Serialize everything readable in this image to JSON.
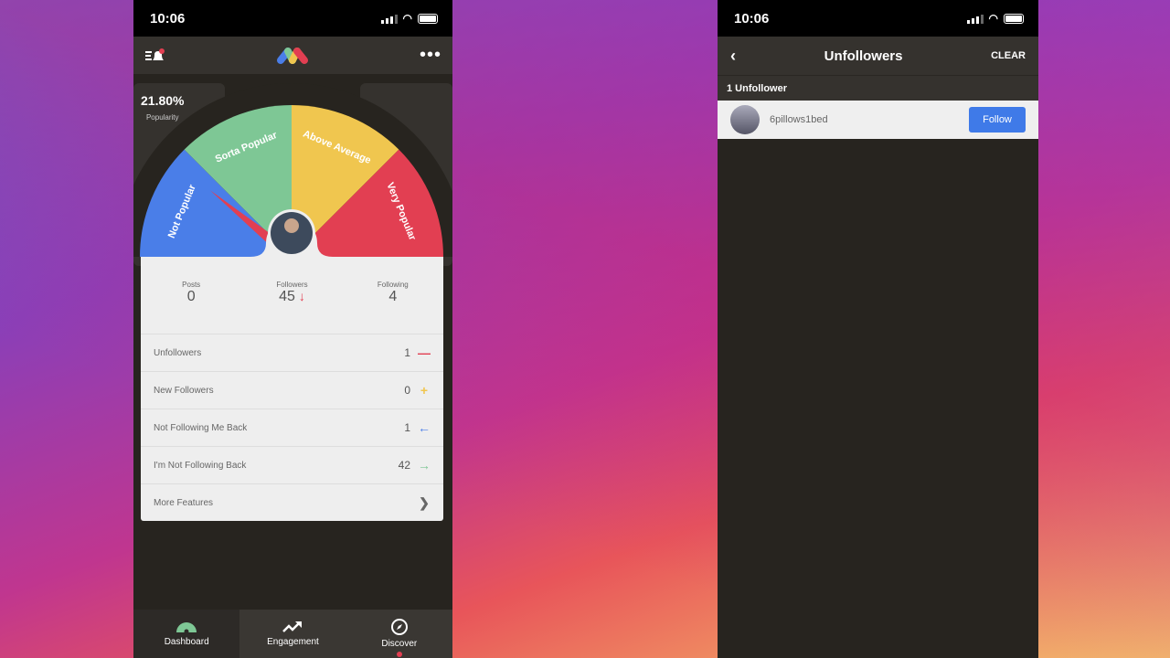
{
  "left": {
    "status": {
      "time": "10:06"
    },
    "popularity": {
      "value": "21.80%",
      "label": "Popularity",
      "fraction": 0.218
    },
    "gauge": {
      "segments": [
        {
          "label": "Not Popular",
          "color": "#4a7ee8"
        },
        {
          "label": "Sorta Popular",
          "color": "#7ec795"
        },
        {
          "label": "Above Average",
          "color": "#f0c64f"
        },
        {
          "label": "Very Popular",
          "color": "#e23f52"
        }
      ]
    },
    "stats": [
      {
        "label": "Posts",
        "value": "0"
      },
      {
        "label": "Followers",
        "value": "45"
      },
      {
        "label": "Following",
        "value": "4"
      }
    ],
    "rows": [
      {
        "label": "Unfollowers",
        "count": "1",
        "icon": "minus-icon",
        "color": "#e23f52"
      },
      {
        "label": "New Followers",
        "count": "0",
        "icon": "plus-icon",
        "color": "#f0c64f"
      },
      {
        "label": "Not Following Me Back",
        "count": "1",
        "icon": "arrow-left-icon",
        "color": "#4a7ee8"
      },
      {
        "label": "I'm Not Following Back",
        "count": "42",
        "icon": "arrow-right-icon",
        "color": "#7ec795"
      },
      {
        "label": "More Features",
        "count": "",
        "icon": "chevron-right-icon",
        "color": "#666666"
      }
    ],
    "tabs": [
      {
        "label": "Dashboard"
      },
      {
        "label": "Engagement"
      },
      {
        "label": "Discover"
      }
    ]
  },
  "right": {
    "status": {
      "time": "10:06"
    },
    "title": "Unfollowers",
    "clear": "CLEAR",
    "count_label": "1 Unfollower",
    "users": [
      {
        "name": "6pillows1bed",
        "button": "Follow"
      }
    ]
  }
}
